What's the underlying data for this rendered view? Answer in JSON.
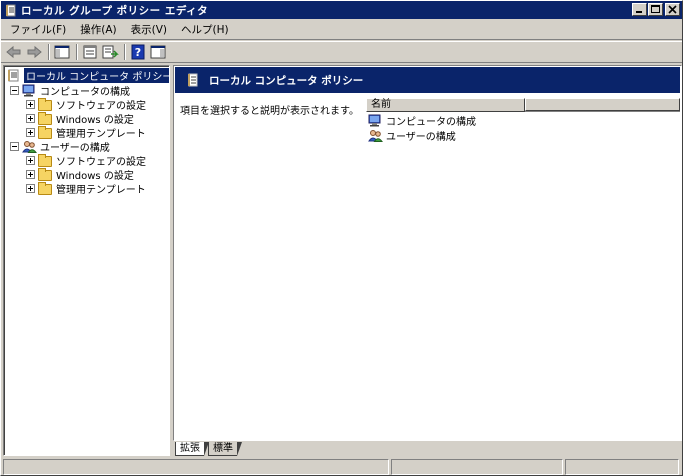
{
  "window": {
    "title": "ローカル グループ ポリシー エディタ",
    "controls": [
      "minimize-icon",
      "maximize-icon",
      "close-icon"
    ]
  },
  "menu": [
    {
      "label": "ファイル(F)"
    },
    {
      "label": "操作(A)"
    },
    {
      "label": "表示(V)"
    },
    {
      "label": "ヘルプ(H)"
    }
  ],
  "toolbar": {
    "buttons": [
      "back-arrow-icon",
      "forward-arrow-icon",
      "show-hide-tree-icon",
      "properties-icon",
      "export-list-icon",
      "help-icon",
      "show-hide-action-pane-icon"
    ]
  },
  "tree": {
    "root": "ローカル コンピュータ ポリシー",
    "computer": {
      "label": "コンピュータの構成",
      "children": [
        "ソフトウェアの設定",
        "Windows の設定",
        "管理用テンプレート"
      ]
    },
    "user": {
      "label": "ユーザーの構成",
      "children": [
        "ソフトウェアの設定",
        "Windows の設定",
        "管理用テンプレート"
      ]
    }
  },
  "details": {
    "header_title": "ローカル コンピュータ ポリシー",
    "description": "項目を選択すると説明が表示されます。",
    "column_name": "名前",
    "items": [
      "コンピュータの構成",
      "ユーザーの構成"
    ]
  },
  "tabs": [
    {
      "label": "拡張",
      "active": true
    },
    {
      "label": "標準",
      "active": false
    }
  ],
  "colors": {
    "titlebar": "#0a246a",
    "face": "#d4d0c8",
    "folder": "#f6d463"
  }
}
